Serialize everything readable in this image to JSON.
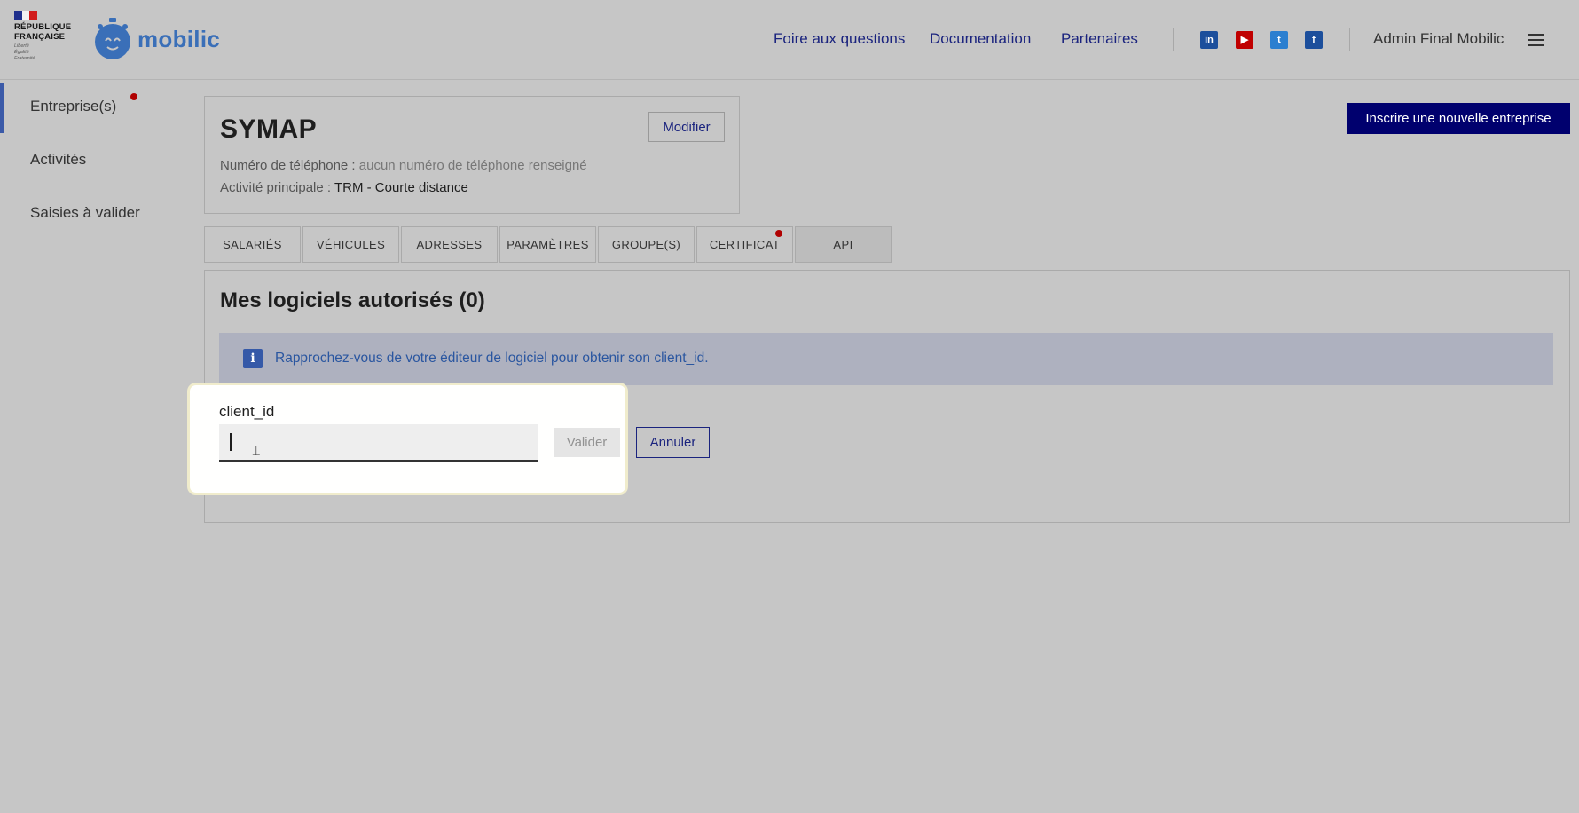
{
  "header": {
    "gov_logo_lines": [
      "RÉPUBLIQUE",
      "FRANÇAISE"
    ],
    "gov_logo_motto": [
      "Liberté",
      "Égalité",
      "Fraternité"
    ],
    "brand": "mobilic",
    "nav": [
      "Foire aux questions",
      "Documentation",
      "Partenaires"
    ],
    "social_icons": [
      "linkedin-icon",
      "youtube-icon",
      "twitter-icon",
      "facebook-icon"
    ],
    "user_name": "Admin Final Mobilic"
  },
  "sidebar": {
    "items": [
      {
        "label": "Entreprise(s)",
        "active": true,
        "notification": true
      },
      {
        "label": "Activités",
        "active": false,
        "notification": false
      },
      {
        "label": "Saisies à valider",
        "active": false,
        "notification": false
      }
    ]
  },
  "company": {
    "name": "SYMAP",
    "edit_label": "Modifier",
    "phone_label": "Numéro de téléphone : ",
    "phone_value": "aucun numéro de téléphone renseigné",
    "activity_label": "Activité principale : ",
    "activity_value": "TRM - Courte distance"
  },
  "new_company_label": "Inscrire une nouvelle entreprise",
  "tabs": [
    {
      "label": "SALARIÉS",
      "active": false
    },
    {
      "label": "VÉHICULES",
      "active": false
    },
    {
      "label": "ADRESSES",
      "active": false
    },
    {
      "label": "PARAMÈTRES",
      "active": false
    },
    {
      "label": "GROUPE(S)",
      "active": false
    },
    {
      "label": "CERTIFICAT",
      "active": false,
      "notification": true
    },
    {
      "label": "API",
      "active": true
    }
  ],
  "api": {
    "title": "Mes logiciels autorisés (0)",
    "info_text": "Rapprochez-vous de votre éditeur de logiciel pour obtenir son client_id.",
    "field_label": "client_id",
    "field_value": "",
    "submit_label": "Valider",
    "cancel_label": "Annuler"
  },
  "colors": {
    "primary_navy": "#00006e",
    "link_blue": "#1a237e",
    "notification_red": "#b00000",
    "info_blue": "#3559a8"
  }
}
